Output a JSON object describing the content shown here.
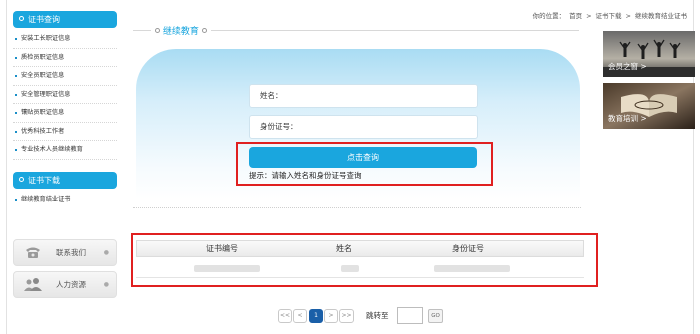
{
  "sidebar": {
    "section1_title": "证书查询",
    "items": [
      "安装工长职证信息",
      "质检员职证信息",
      "安全员职证信息",
      "安全管理职证信息",
      "镶贴员职证信息",
      "优秀科技工作者",
      "专业技术人员继续教育"
    ],
    "section2_title": "证书下载",
    "download_items": [
      "继续教育结业证书"
    ],
    "contact_label": "联系我们",
    "hr_label": "人力资源"
  },
  "breadcrumb": {
    "prefix": "你的位置：",
    "home": "首页",
    "sep": ">",
    "section": "证书下载",
    "current": "继续教育结业证书"
  },
  "page_title": "继续教育",
  "form": {
    "name_label": "姓名：",
    "id_label": "身份证号：",
    "submit_label": "点击查询",
    "hint": "提示：请输入姓名和身份证号查询"
  },
  "table": {
    "headers": [
      "证书编号",
      "姓名",
      "身份证号"
    ]
  },
  "pagination": {
    "first": "<<",
    "prev": "<",
    "current": "1",
    "next": ">",
    "last": ">>",
    "jump_label": "跳转至",
    "go_label": "GO"
  },
  "banners": {
    "member": "会员之窗 >",
    "training": "教育培训 >"
  },
  "colors": {
    "accent": "#1aa6de",
    "highlight": "#e02020",
    "page_active": "#1a5fa8"
  }
}
